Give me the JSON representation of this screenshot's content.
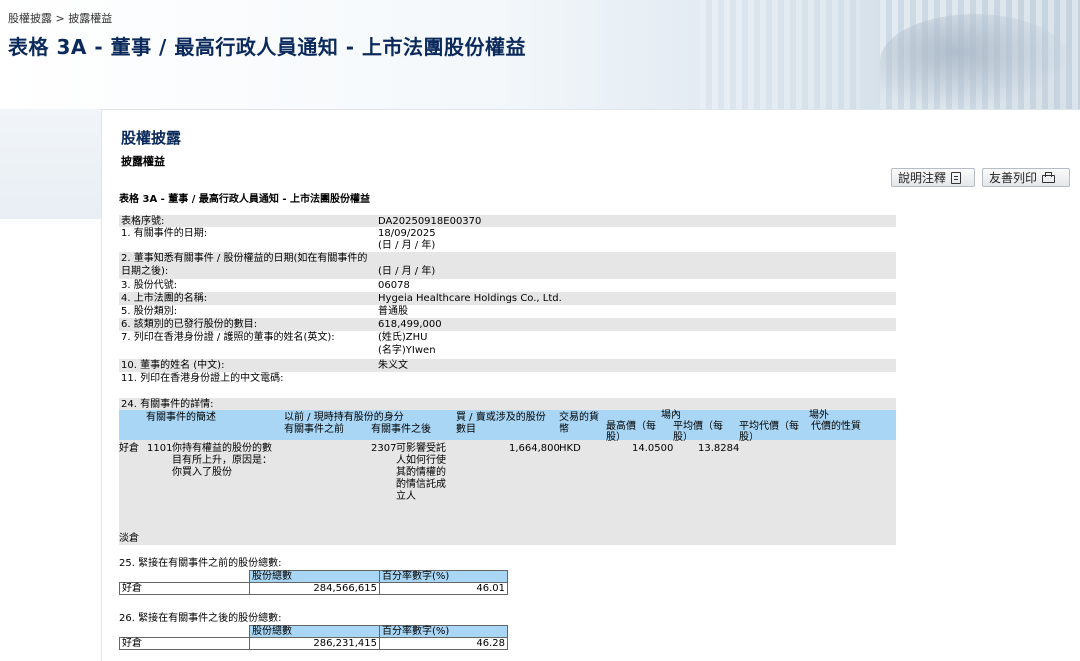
{
  "header": {
    "breadcrumb": "股權披露 > 披露權益",
    "title": "表格 3A - 董事 / 最高行政人員通知 - 上市法團股份權益"
  },
  "panel": {
    "section_title": "股權披露",
    "subsection_title": "披露權益",
    "form_title": "表格 3A - 董事 / 最高行政人員通知 - 上市法團股份權益"
  },
  "toolbar": {
    "notes_label": "說明注釋",
    "notes_icon": "document-icon",
    "print_label": "友善列印",
    "print_icon": "printer-icon"
  },
  "fields": {
    "serial": {
      "label": "表格序號:",
      "value": "DA20250918E00370"
    },
    "event_date": {
      "label": "1. 有關事件的日期:",
      "value": "18/09/2025",
      "format": "(日 / 月 / 年)"
    },
    "aware_date": {
      "label1": "2. 董事知悉有關事件 / 股份權益的日期(如在有關事件的",
      "label2": "日期之後):",
      "format": "(日 / 月 / 年)"
    },
    "stock_code": {
      "label": "3. 股份代號:",
      "value": "06078"
    },
    "corp_name": {
      "label": "4. 上市法團的名稱:",
      "value": "Hygeia Healthcare Holdings Co., Ltd."
    },
    "share_class": {
      "label": "5. 股份類別:",
      "value": "普通股"
    },
    "issued_shares": {
      "label": "6. 該類別的已發行股份的數目:",
      "value": "618,499,000"
    },
    "director_name_en": {
      "label": "7. 列印在香港身份證 / 護照的董事的姓名(英文):",
      "surname": "(姓氏)ZHU",
      "given": "(名字)YIwen"
    },
    "director_name_cn": {
      "label": "10. 董事的姓名 (中文):",
      "value": "朱义文"
    },
    "hkid_code": {
      "label": "11. 列印在香港身份證上的中文電碼:"
    }
  },
  "section24": {
    "title": "24. 有關事件的詳情:",
    "headers": {
      "event": "有關事件的簡述",
      "capacity": "以前 / 現時持有股份的身分",
      "before": "有關事件之前",
      "after": "有關事件之後",
      "shares1": "買 / 賣或涉及的股份",
      "shares2": "數目",
      "currency1": "交易的貨",
      "currency2": "幣",
      "onex": "場內",
      "high1": "最高價（每",
      "high2": "股）",
      "avg1": "平均價（每",
      "avg2": "股）",
      "offex": "場外",
      "avg_off1": "平均代價（每",
      "avg_off2": "股）",
      "consideration": "代價的性質"
    },
    "row": {
      "position": "好倉",
      "code": "1101",
      "desc": [
        "你持有權益的股份的數",
        "目有所上升，原因是：",
        "你買入了股份"
      ],
      "after_code": "2307",
      "after_desc": [
        "可影響受託",
        "人如何行使",
        "其酌情權的",
        "酌情信託成",
        "立人"
      ],
      "shares": "1,664,800",
      "currency": "HKD",
      "high": "14.0500",
      "avg": "13.8284"
    },
    "short_label": "淡倉"
  },
  "section25": {
    "title": "25. 緊接在有關事件之前的股份總數:",
    "col_shares": "股份總數",
    "col_pct": "百分率數字(%)",
    "row_label": "好倉",
    "shares": "284,566,615",
    "pct": "46.01"
  },
  "section26": {
    "title": "26. 緊接在有關事件之後的股份總數:",
    "col_shares": "股份總數",
    "col_pct": "百分率數字(%)",
    "row_label": "好倉",
    "shares": "286,231,415",
    "pct": "46.28"
  }
}
